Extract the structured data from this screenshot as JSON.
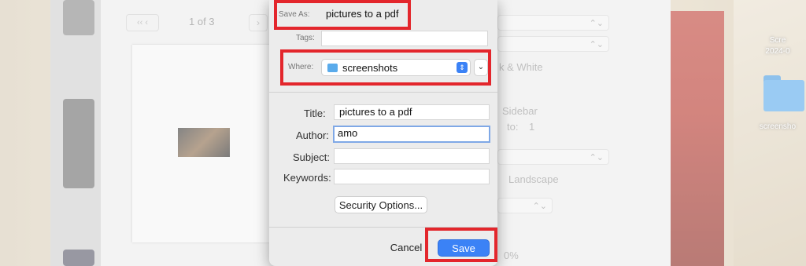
{
  "desktop": {
    "icon_label_top": "Scre",
    "icon_label_date": "2024-0",
    "folder_label": "screensho"
  },
  "background_window": {
    "page_counter": "1 of 3",
    "nav_prev": "‹‹ ‹",
    "nav_next": "›",
    "bw_option_text": "k & White",
    "sidebar_text": "Sidebar",
    "to_text": "to:",
    "to_value": "1",
    "landscape_text": "Landscape",
    "percent_text": "0%"
  },
  "dialog": {
    "save_as_label": "Save As:",
    "save_as_value": "pictures to a pdf",
    "tags_label": "Tags:",
    "tags_value": "",
    "where_label": "Where:",
    "where_value": "screenshots",
    "title_label": "Title:",
    "title_value": "pictures to a pdf",
    "author_label": "Author:",
    "author_value": "amo",
    "subject_label": "Subject:",
    "subject_value": "",
    "keywords_label": "Keywords:",
    "keywords_value": "",
    "security_button": "Security Options...",
    "cancel_button": "Cancel",
    "save_button": "Save"
  },
  "colors": {
    "highlight": "#e3262c",
    "primary": "#3b82f6"
  }
}
